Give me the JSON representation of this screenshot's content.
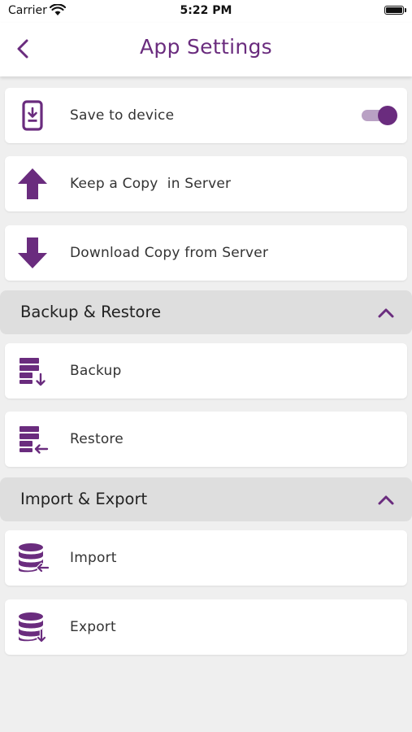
{
  "status_bar": {
    "carrier": "Carrier",
    "time": "5:22 PM"
  },
  "header": {
    "title": "App Settings"
  },
  "settings": {
    "save_to_device": {
      "label": "Save to device",
      "enabled": true
    },
    "keep_copy": {
      "label": "Keep a Copy  in Server"
    },
    "download_copy": {
      "label": "Download Copy from Server"
    }
  },
  "backup_section": {
    "title": "Backup & Restore",
    "items": [
      {
        "label": "Backup"
      },
      {
        "label": "Restore"
      }
    ]
  },
  "import_section": {
    "title": "Import & Export",
    "items": [
      {
        "label": "Import"
      },
      {
        "label": "Export"
      }
    ]
  },
  "colors": {
    "accent": "#6a2c7e",
    "background": "#efefef",
    "section": "#dedede"
  }
}
